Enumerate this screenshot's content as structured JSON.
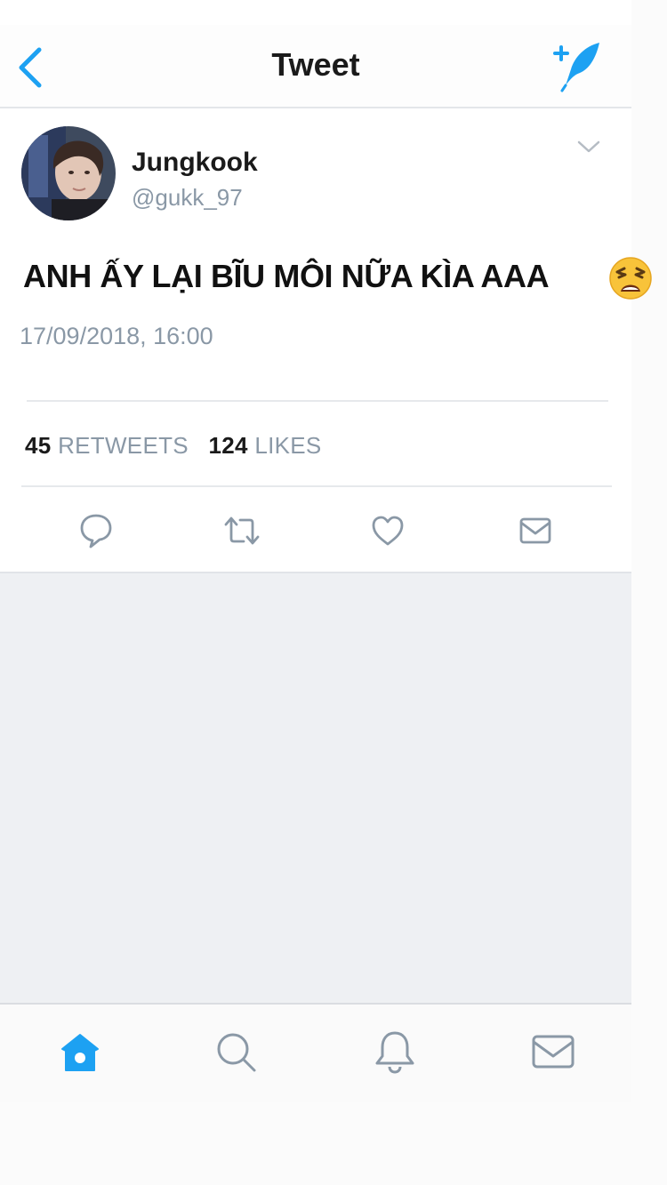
{
  "navbar": {
    "title": "Tweet"
  },
  "tweet": {
    "display_name": "Jungkook",
    "handle": "@gukk_97",
    "text": "ANH ẤY LẠI BĨU MÔI NỮA KÌA AAA",
    "timestamp": "17/09/2018, 16:00",
    "retweets_count": "45",
    "retweets_label": "RETWEETS",
    "likes_count": "124",
    "likes_label": "LIKES"
  },
  "icons": {
    "back": "chevron-left-icon",
    "compose": "compose-feather-icon",
    "more": "chevron-down-icon",
    "emoji": "weary-face-emoji",
    "reply": "reply-bubble-icon",
    "retweet": "retweet-icon",
    "like": "heart-icon",
    "dm": "envelope-icon",
    "tab_home": "home-icon",
    "tab_search": "search-icon",
    "tab_notifications": "bell-icon",
    "tab_messages": "envelope-icon"
  },
  "colors": {
    "accent": "#1da1f2",
    "muted_text": "#8a98a6",
    "icon_gray": "#8a98a6"
  }
}
